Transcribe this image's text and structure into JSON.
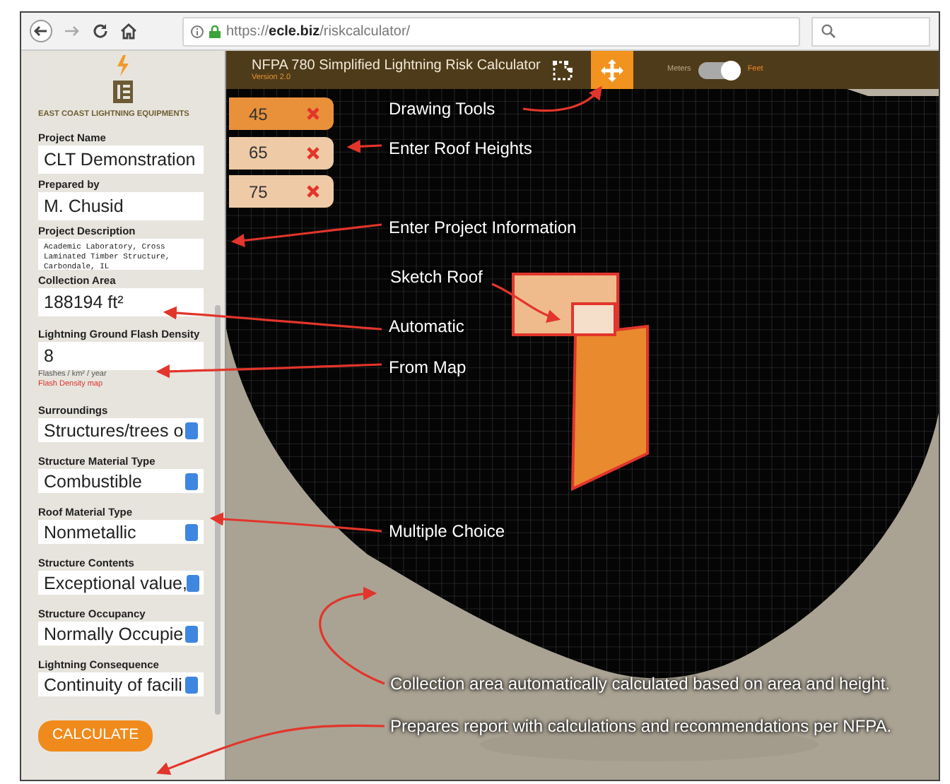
{
  "browser": {
    "url_scheme": "https://",
    "url_domain": "ecle.biz",
    "url_path": "/riskcalculator/"
  },
  "sidebar": {
    "company": "EAST COAST LIGHTNING EQUIPMENTS",
    "fields": [
      {
        "kind": "text",
        "label": "Project Name",
        "value": "CLT Demonstration"
      },
      {
        "kind": "text",
        "label": "Prepared by",
        "value": "M. Chusid"
      },
      {
        "kind": "textarea",
        "label": "Project Description",
        "value": "Academic Laboratory, Cross Laminated Timber Structure, Carbondale, IL"
      },
      {
        "kind": "text",
        "label": "Collection Area",
        "value": "188194 ft²"
      },
      {
        "kind": "text",
        "label": "Lightning Ground Flash Density",
        "value": "8",
        "note": "Flashes / km² / year",
        "link": "Flash Density map"
      },
      {
        "kind": "select",
        "label": "Surroundings",
        "value": "Structures/trees o"
      },
      {
        "kind": "select",
        "label": "Structure Material Type",
        "value": "Combustible"
      },
      {
        "kind": "select",
        "label": "Roof Material Type",
        "value": "Nonmetallic"
      },
      {
        "kind": "select",
        "label": "Structure Contents",
        "value": "Exceptional value,"
      },
      {
        "kind": "select",
        "label": "Structure Occupancy",
        "value": "Normally Occupie"
      },
      {
        "kind": "select",
        "label": "Lightning Consequence",
        "value": "Continuity of facili"
      }
    ],
    "button": "CALCULATE"
  },
  "header": {
    "title": "NFPA 780 Simplified Lightning Risk Calculator",
    "version": "Version 2.0",
    "tools": [
      {
        "kind": "polygon",
        "selected": false
      },
      {
        "kind": "move",
        "selected": true
      }
    ],
    "unit_toggle": {
      "left": "Meters",
      "right": "Feet",
      "on": true
    }
  },
  "heights": [
    {
      "value": "45",
      "selected": true
    },
    {
      "value": "65",
      "selected": false
    },
    {
      "value": "75",
      "selected": false
    }
  ],
  "annotations": [
    {
      "text": "Drawing Tools"
    },
    {
      "text": "Enter Roof Heights"
    },
    {
      "text": "Enter Project Information"
    },
    {
      "text": "Sketch Roof"
    },
    {
      "text": "Automatic"
    },
    {
      "text": "From Map"
    },
    {
      "text": "Multiple Choice"
    },
    {
      "text": "Collection area automatically calculated based on area and height."
    },
    {
      "text": "Prepares report with calculations and recommendations per NFPA."
    }
  ]
}
